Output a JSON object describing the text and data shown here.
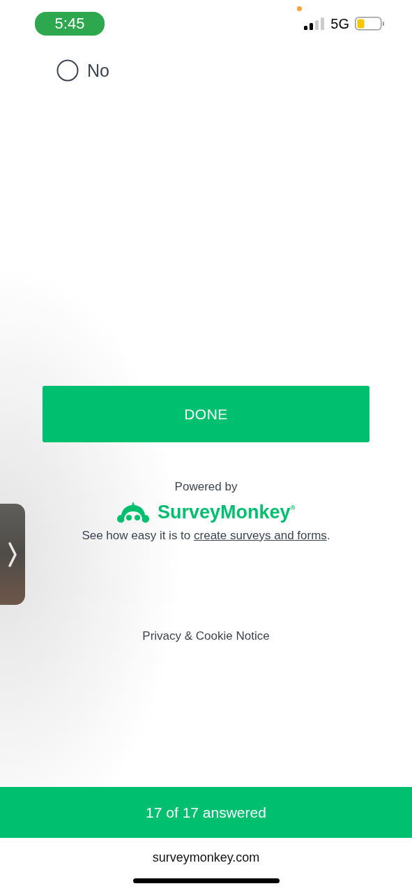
{
  "status_bar": {
    "time": "5:45",
    "network": "5G"
  },
  "question": {
    "options": [
      {
        "label": "No",
        "selected": false
      }
    ]
  },
  "done_button": {
    "label": "DONE"
  },
  "branding": {
    "powered_by": "Powered by",
    "logo_text": "SurveyMonkey$^{®}$",
    "promo": {
      "text": "See how easy it is to ",
      "link": "create surveys and forms",
      "end": "."
    }
  },
  "privacy_link": "Privacy & Cookie Notice",
  "progress": {
    "label": "17 of 17 answered"
  },
  "browser": {
    "url": "surveymonkey.com"
  }
}
